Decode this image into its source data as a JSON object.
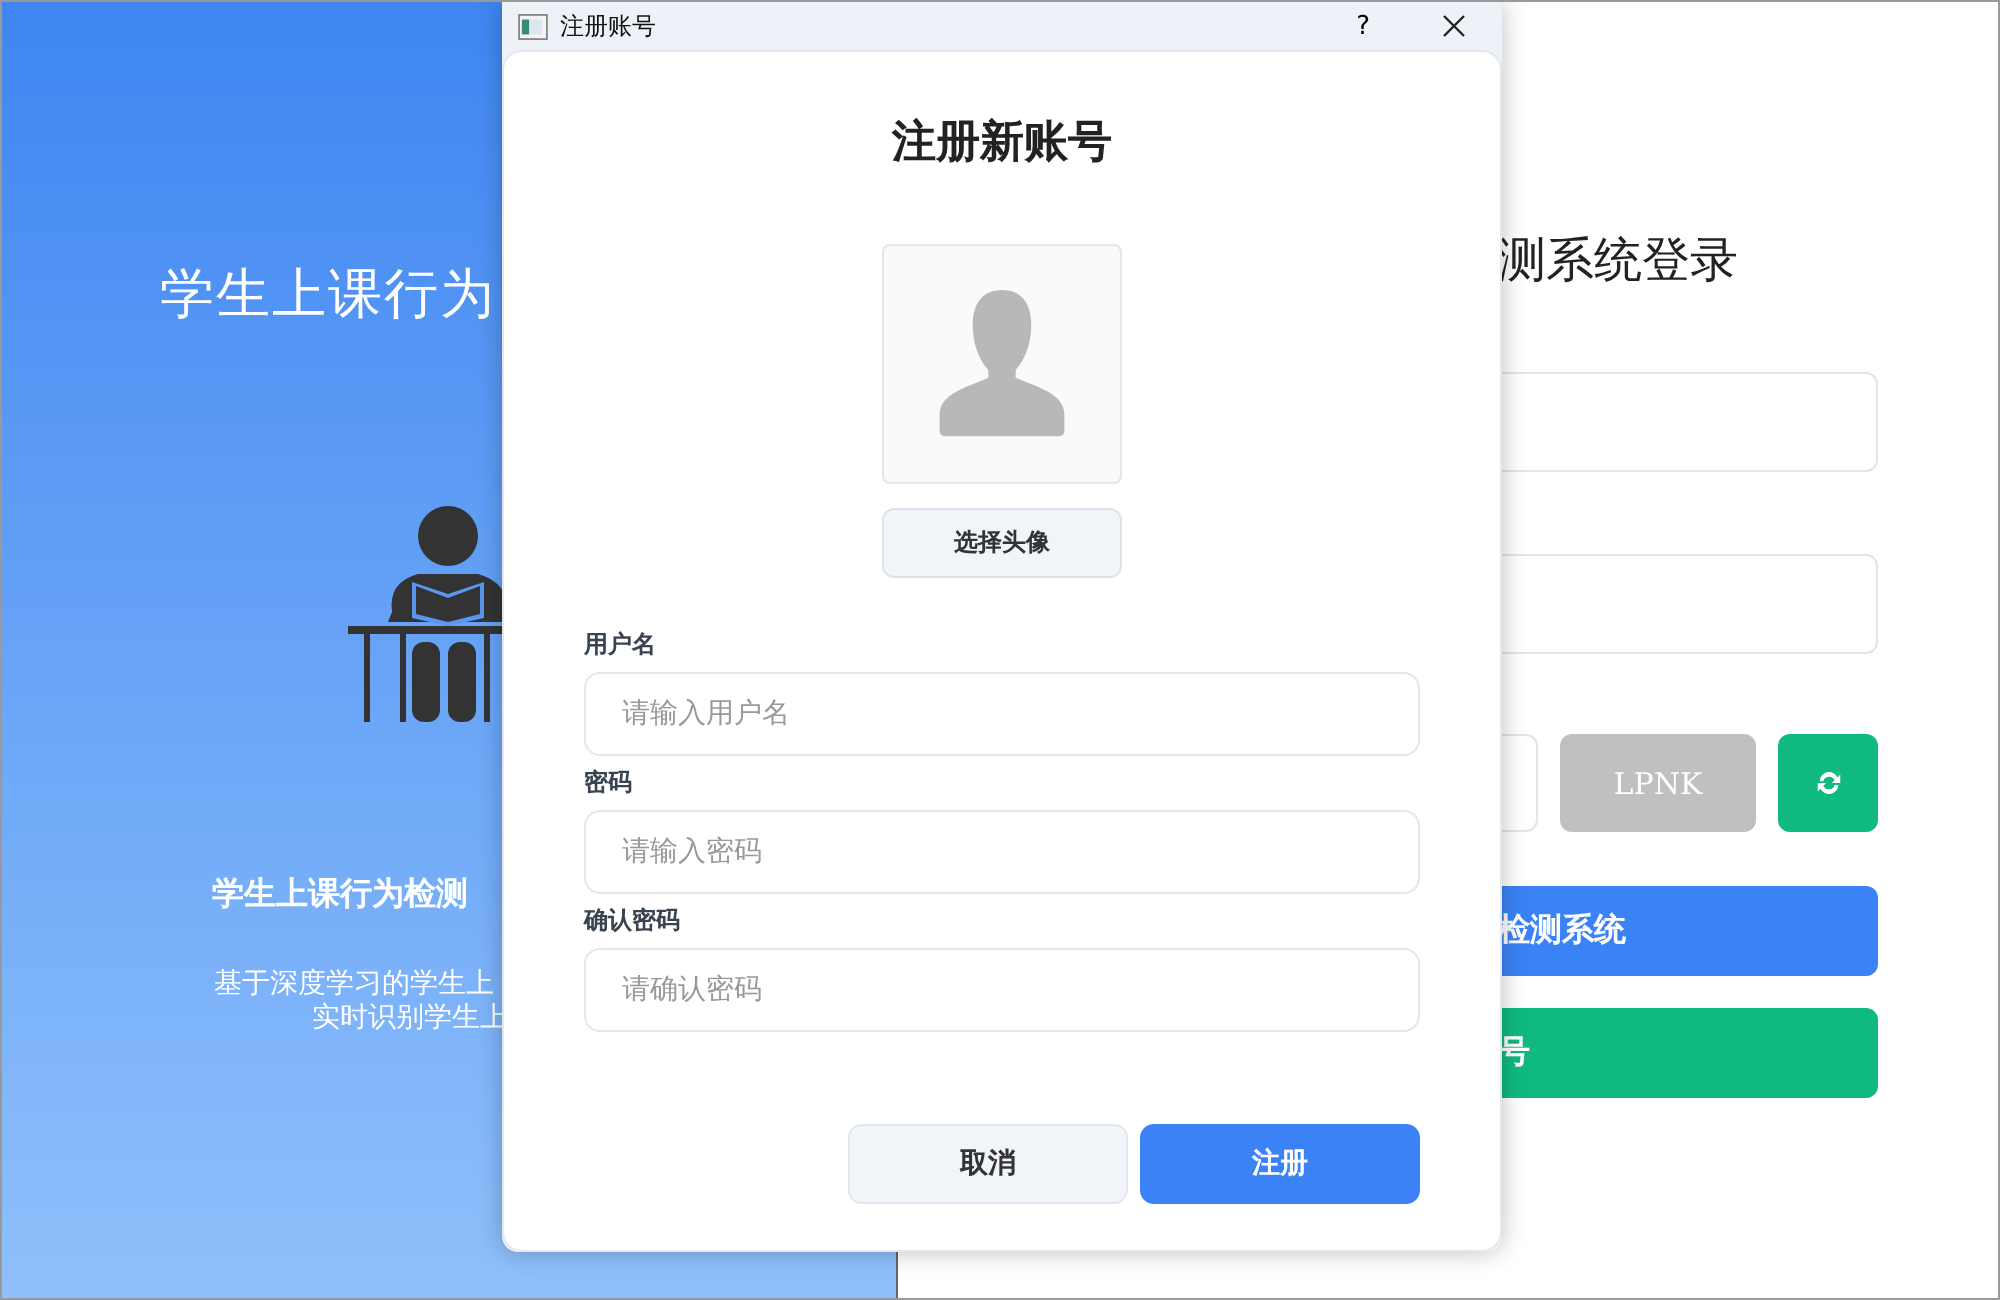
{
  "background_window": {
    "left_panel": {
      "title": "学生上课行为",
      "subtitle": "学生上课行为检测",
      "description_lines": [
        "基于深度学习的学生上",
        "实时识别学生上"
      ]
    },
    "right_panel": {
      "title": "测系统登录",
      "fields": [
        {
          "kind": "input"
        },
        {
          "kind": "input"
        }
      ],
      "captcha": {
        "code": "LPNK"
      },
      "buttons": [
        {
          "label": "检测系统",
          "color": "#3b82f6"
        },
        {
          "label": "号",
          "color": "#10b981"
        }
      ]
    }
  },
  "dialog": {
    "title": "注册账号",
    "help": "?",
    "heading": "注册新账号",
    "avatar_button": "选择头像",
    "fields": [
      {
        "label": "用户名",
        "placeholder": "请输入用户名"
      },
      {
        "label": "密码",
        "placeholder": "请输入密码"
      },
      {
        "label": "确认密码",
        "placeholder": "请确认密码"
      }
    ],
    "buttons": [
      {
        "label": "取消",
        "kind": "secondary"
      },
      {
        "label": "注册",
        "kind": "primary"
      }
    ]
  }
}
